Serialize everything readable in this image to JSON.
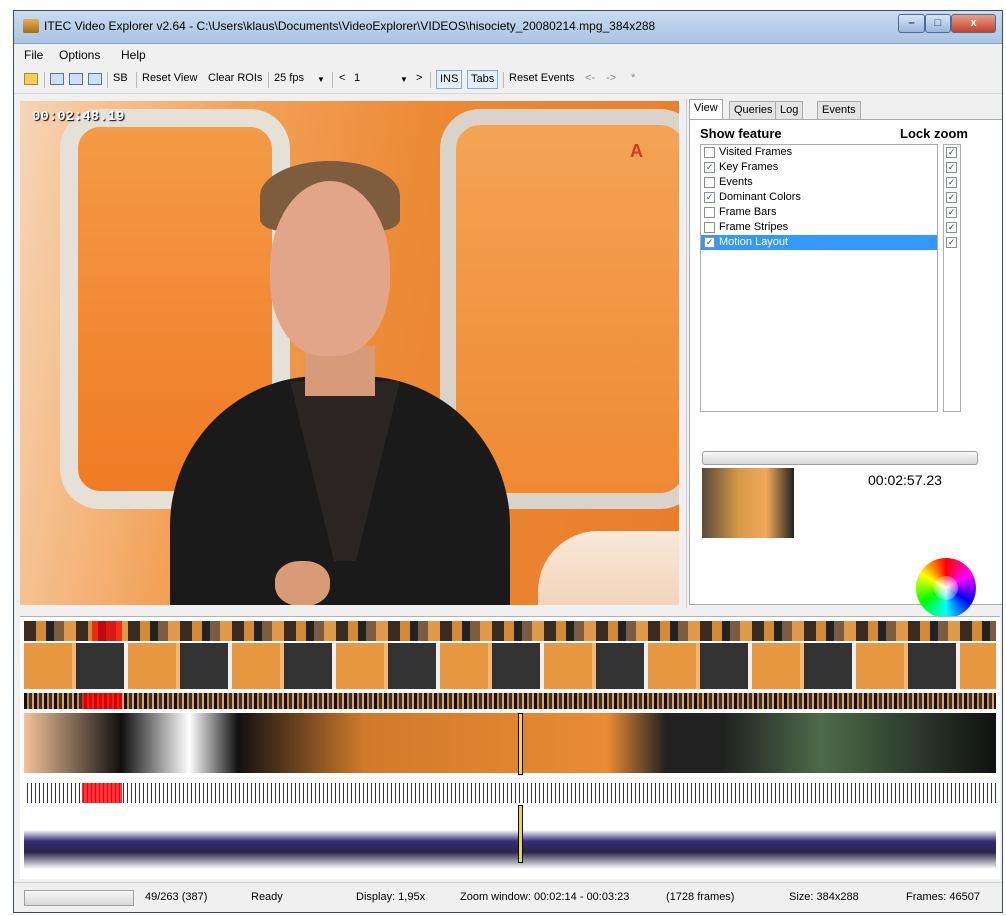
{
  "window": {
    "title": "ITEC Video Explorer v2.64 - C:\\Users\\klaus\\Documents\\VideoExplorer\\VIDEOS\\hisociety_20080214.mpg_384x288",
    "min_label": "–",
    "max_label": "□",
    "close_label": "x"
  },
  "menu": {
    "file": "File",
    "options": "Options",
    "help": "Help"
  },
  "toolbar": {
    "sb": "SB",
    "reset_view": "Reset View",
    "clear_rois": "Clear ROIs",
    "fps": "25 fps",
    "prev": "<",
    "page": "1",
    "next": ">",
    "ins": "INS",
    "tabs": "Tabs",
    "reset_events": "Reset Events",
    "back": "<-",
    "forward": "->",
    "star": "*"
  },
  "video": {
    "timestamp": "00:02:48.19",
    "logo_text": "A"
  },
  "panel": {
    "tabs": [
      "View",
      "Queries",
      "Log",
      "Events"
    ],
    "show_feature": "Show feature",
    "lock_zoom": "Lock zoom",
    "features": [
      {
        "label": "Visited Frames",
        "checked": false,
        "locked": true
      },
      {
        "label": "Key Frames",
        "checked": true,
        "locked": true
      },
      {
        "label": "Events",
        "checked": false,
        "locked": true
      },
      {
        "label": "Dominant Colors",
        "checked": true,
        "locked": true
      },
      {
        "label": "Frame Bars",
        "checked": false,
        "locked": true
      },
      {
        "label": "Frame Stripes",
        "checked": false,
        "locked": true
      },
      {
        "label": "Motion Layout",
        "checked": true,
        "locked": true,
        "selected": true
      }
    ],
    "thumb_time": "00:02:57.23"
  },
  "status": {
    "frames_count": "49/263 (387)",
    "state": "Ready",
    "display": "Display: 1,95x",
    "zoom_window": "Zoom window: 00:02:14 - 00:03:23",
    "zoom_frames": "(1728 frames)",
    "size": "Size: 384x288",
    "frames_total": "Frames: 46507"
  }
}
